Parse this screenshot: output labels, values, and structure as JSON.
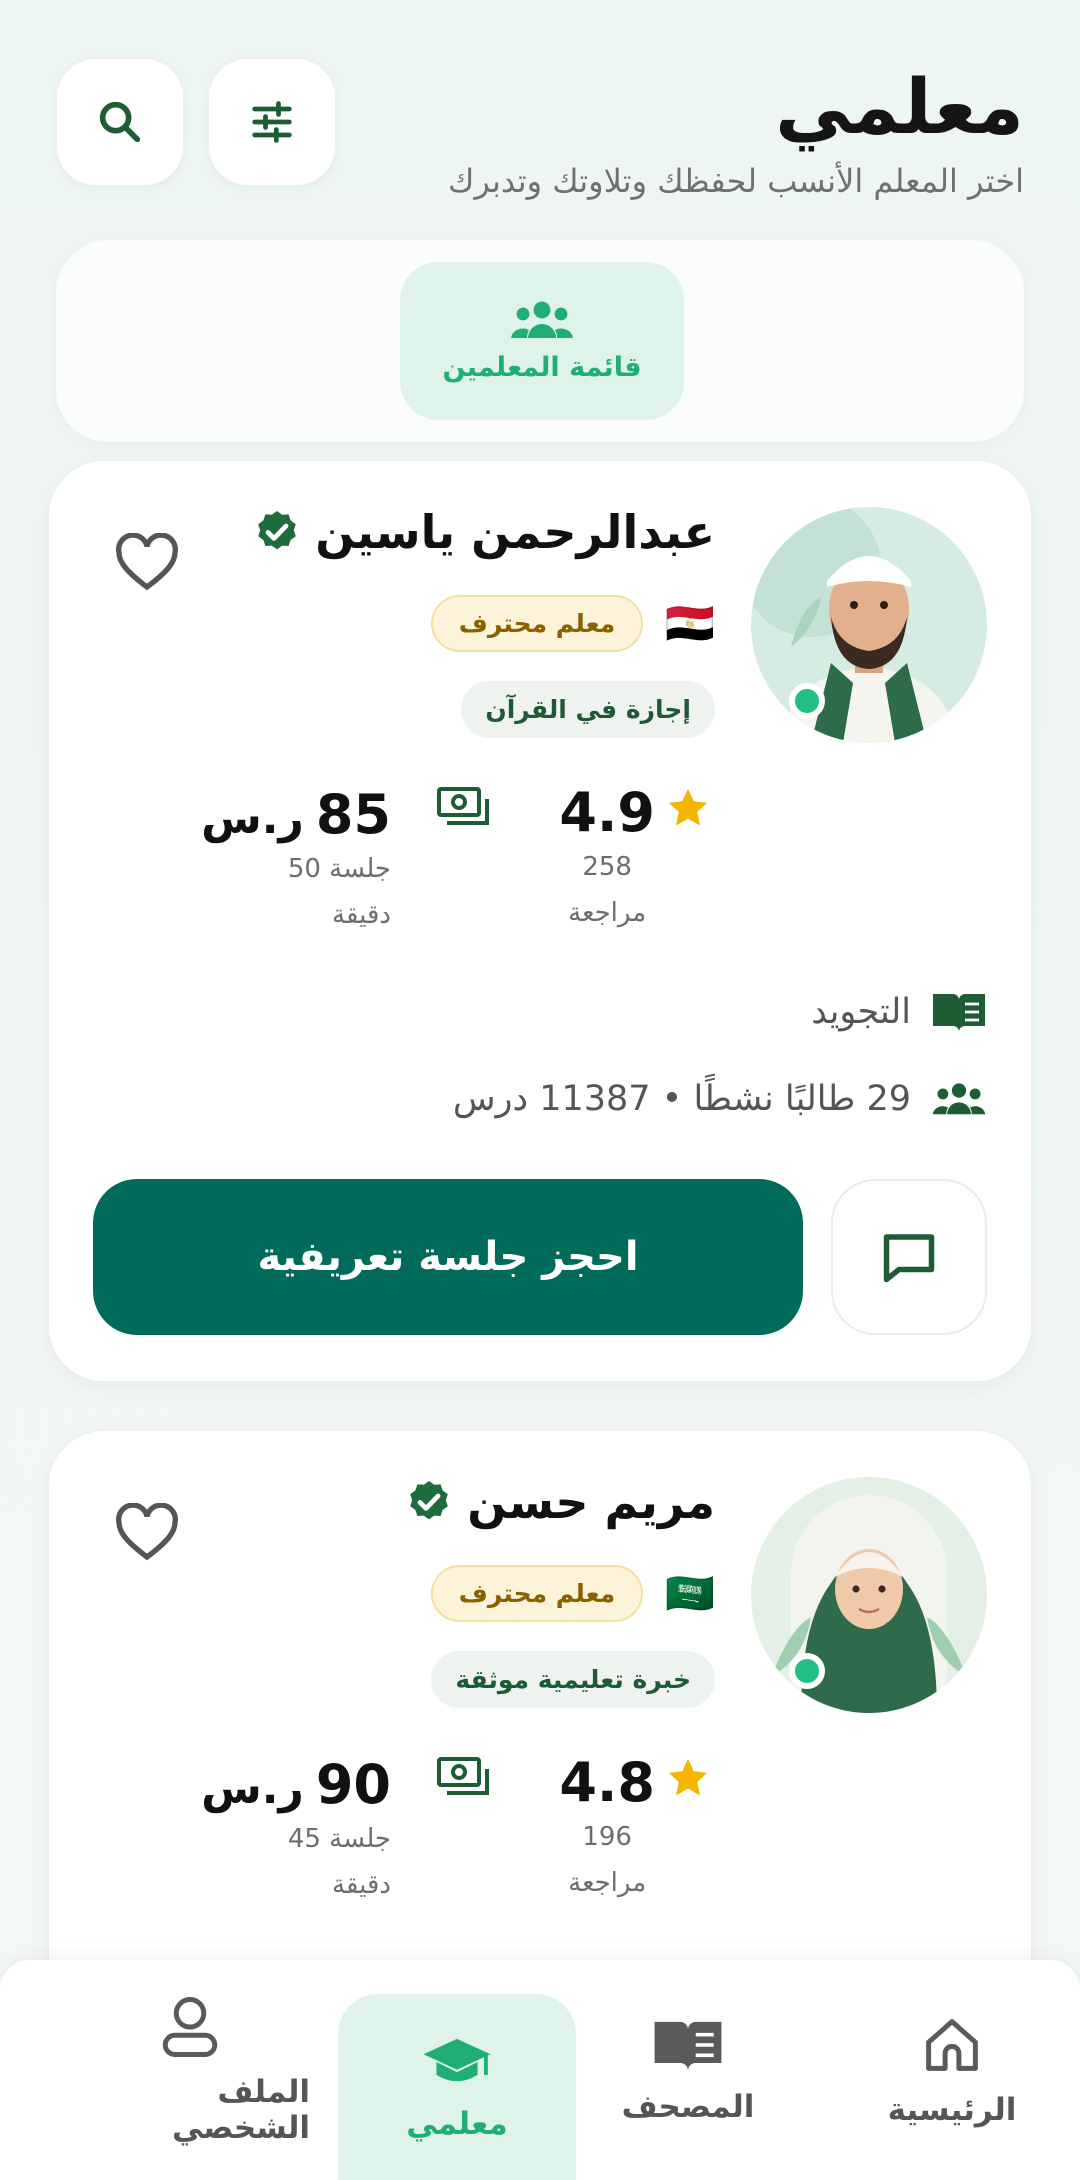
{
  "header": {
    "title": "معلمي",
    "subtitle": "اختر المعلم الأنسب لحفظك وتلاوتك وتدبرك",
    "search_icon": "search-icon",
    "filter_icon": "sliders-icon"
  },
  "tabs": [
    {
      "label": "قائمة المعلمين",
      "icon": "group-icon",
      "active": true
    }
  ],
  "teachers": [
    {
      "name": "عبدالرحمن ياسين",
      "verified": true,
      "flag": "🇪🇬",
      "level_badge": "معلم محترف",
      "credential_badge": "إجازة في القرآن",
      "rating": "4.9",
      "reviews_count": "258",
      "reviews_label": "مراجعة",
      "price": "85",
      "currency": "ر.س",
      "session_label": "جلسة 50 دقيقة",
      "specialty": "التجويد",
      "stats": "29 طالبًا نشطًا • 11387 درس",
      "book_label": "احجز جلسة تعريفية",
      "online": true
    },
    {
      "name": "مريم حسن",
      "verified": true,
      "flag": "🇸🇦",
      "level_badge": "معلم محترف",
      "credential_badge": "خبرة تعليمية موثقة",
      "rating": "4.8",
      "reviews_count": "196",
      "reviews_label": "مراجعة",
      "price": "90",
      "currency": "ر.س",
      "session_label": "جلسة 45 دقيقة",
      "online": true
    }
  ],
  "bottom_nav": [
    {
      "label": "الرئيسية",
      "icon": "home-icon",
      "active": false
    },
    {
      "label": "المصحف",
      "icon": "book-icon",
      "active": false
    },
    {
      "label": "معلمي",
      "icon": "graduation-cap-icon",
      "active": true
    },
    {
      "label": "الملف الشخصي",
      "icon": "user-icon",
      "active": false
    }
  ],
  "colors": {
    "primary": "#006b5a",
    "accent_green": "#1fae74",
    "dark_green": "#1e5c34",
    "star": "#f4b400",
    "background": "#eef6f2"
  }
}
